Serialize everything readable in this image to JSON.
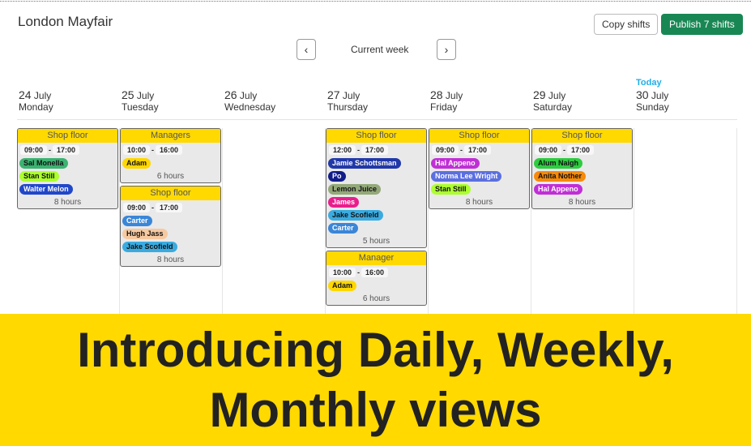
{
  "header": {
    "title": "London Mayfair",
    "copy_label": "Copy shifts",
    "publish_label": "Publish 7 shifts",
    "week_label": "Current week",
    "prev_icon": "chevron-left-icon",
    "next_icon": "chevron-right-icon"
  },
  "days": [
    {
      "num": "24",
      "month": "July",
      "name": "Monday",
      "today": ""
    },
    {
      "num": "25",
      "month": "July",
      "name": "Tuesday",
      "today": ""
    },
    {
      "num": "26",
      "month": "July",
      "name": "Wednesday",
      "today": ""
    },
    {
      "num": "27",
      "month": "July",
      "name": "Thursday",
      "today": ""
    },
    {
      "num": "28",
      "month": "July",
      "name": "Friday",
      "today": ""
    },
    {
      "num": "29",
      "month": "July",
      "name": "Saturday",
      "today": ""
    },
    {
      "num": "30",
      "month": "July",
      "name": "Sunday",
      "today": "Today"
    }
  ],
  "shifts": [
    {
      "day": 0,
      "row": 0,
      "title": "Shop floor",
      "start": "09:00",
      "end": "17:00",
      "hours": "8 hours",
      "staff": [
        {
          "name": "Sal Monella",
          "bg": "#3cb371",
          "fg": "#111"
        },
        {
          "name": "Stan Still",
          "bg": "#adff2f",
          "fg": "#111"
        },
        {
          "name": "Walter Melon",
          "bg": "#2147c9",
          "fg": "#fff"
        }
      ]
    },
    {
      "day": 1,
      "row": 0,
      "title": "Managers",
      "start": "10:00",
      "end": "16:00",
      "hours": "6 hours",
      "staff": [
        {
          "name": "Adam",
          "bg": "#ffd700",
          "fg": "#111"
        }
      ]
    },
    {
      "day": 1,
      "row": 1,
      "title": "Shop floor",
      "start": "09:00",
      "end": "17:00",
      "hours": "8 hours",
      "staff": [
        {
          "name": "Carter",
          "bg": "#3a86d8",
          "fg": "#fff"
        },
        {
          "name": "Hugh Jass",
          "bg": "#f6c9a0",
          "fg": "#111"
        },
        {
          "name": "Jake Scofield",
          "bg": "#3aabe0",
          "fg": "#111"
        }
      ]
    },
    {
      "day": 3,
      "row": 0,
      "title": "Shop floor",
      "start": "12:00",
      "end": "17:00",
      "hours": "5 hours",
      "staff": [
        {
          "name": "Jamie Schottsman",
          "bg": "#2138a8",
          "fg": "#fff"
        },
        {
          "name": "Po",
          "bg": "#101c8a",
          "fg": "#fff"
        },
        {
          "name": "Lemon Juice",
          "bg": "#94a97a",
          "fg": "#111"
        },
        {
          "name": "James",
          "bg": "#e91e8c",
          "fg": "#fff"
        },
        {
          "name": "Jake Scofield",
          "bg": "#3aabe0",
          "fg": "#111"
        },
        {
          "name": "Carter",
          "bg": "#3a86d8",
          "fg": "#fff"
        }
      ]
    },
    {
      "day": 3,
      "row": 1,
      "title": "Manager",
      "start": "10:00",
      "end": "16:00",
      "hours": "6 hours",
      "staff": [
        {
          "name": "Adam",
          "bg": "#ffd700",
          "fg": "#111"
        }
      ]
    },
    {
      "day": 4,
      "row": 0,
      "title": "Shop floor",
      "start": "09:00",
      "end": "17:00",
      "hours": "8 hours",
      "staff": [
        {
          "name": "Hal Appeno",
          "bg": "#c02fd6",
          "fg": "#fff"
        },
        {
          "name": "Norma Lee Wright",
          "bg": "#5b6fe0",
          "fg": "#fff"
        },
        {
          "name": "Stan Still",
          "bg": "#adff2f",
          "fg": "#111"
        }
      ]
    },
    {
      "day": 5,
      "row": 0,
      "title": "Shop floor",
      "start": "09:00",
      "end": "17:00",
      "hours": "8 hours",
      "staff": [
        {
          "name": "Alum Naigh",
          "bg": "#2ecc40",
          "fg": "#111"
        },
        {
          "name": "Anita Nother",
          "bg": "#f58a0b",
          "fg": "#111"
        },
        {
          "name": "Hal Appeno",
          "bg": "#c02fd6",
          "fg": "#fff"
        }
      ]
    }
  ],
  "banner": {
    "line1": "Introducing Daily, Weekly,",
    "line2": "Monthly views"
  }
}
